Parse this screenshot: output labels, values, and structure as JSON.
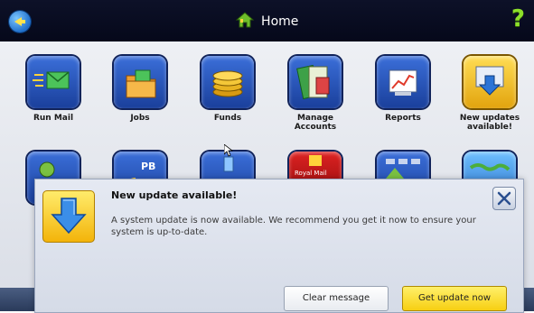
{
  "header": {
    "title": "Home",
    "help_label": "?"
  },
  "tiles": [
    {
      "label": "Run Mail"
    },
    {
      "label": "Jobs"
    },
    {
      "label": "Funds"
    },
    {
      "label": "Manage\nAccounts"
    },
    {
      "label": "Reports"
    },
    {
      "label": "New updates\navailable!"
    }
  ],
  "second_row_tiles": [
    {
      "icon_badge": "PB"
    },
    {
      "icon_text": "Royal Mail"
    }
  ],
  "dialog": {
    "title": "New update available!",
    "message": "A system update is now available. We recommend you get it now to ensure your system is up-to-date.",
    "clear_button": "Clear message",
    "update_button": "Get update now"
  },
  "colors": {
    "header_bg": "#0d1128",
    "tile_blue": "#2a55c0",
    "tile_gold": "#f3b40a",
    "help_green": "#8de02a",
    "update_button": "#f7cf12"
  }
}
